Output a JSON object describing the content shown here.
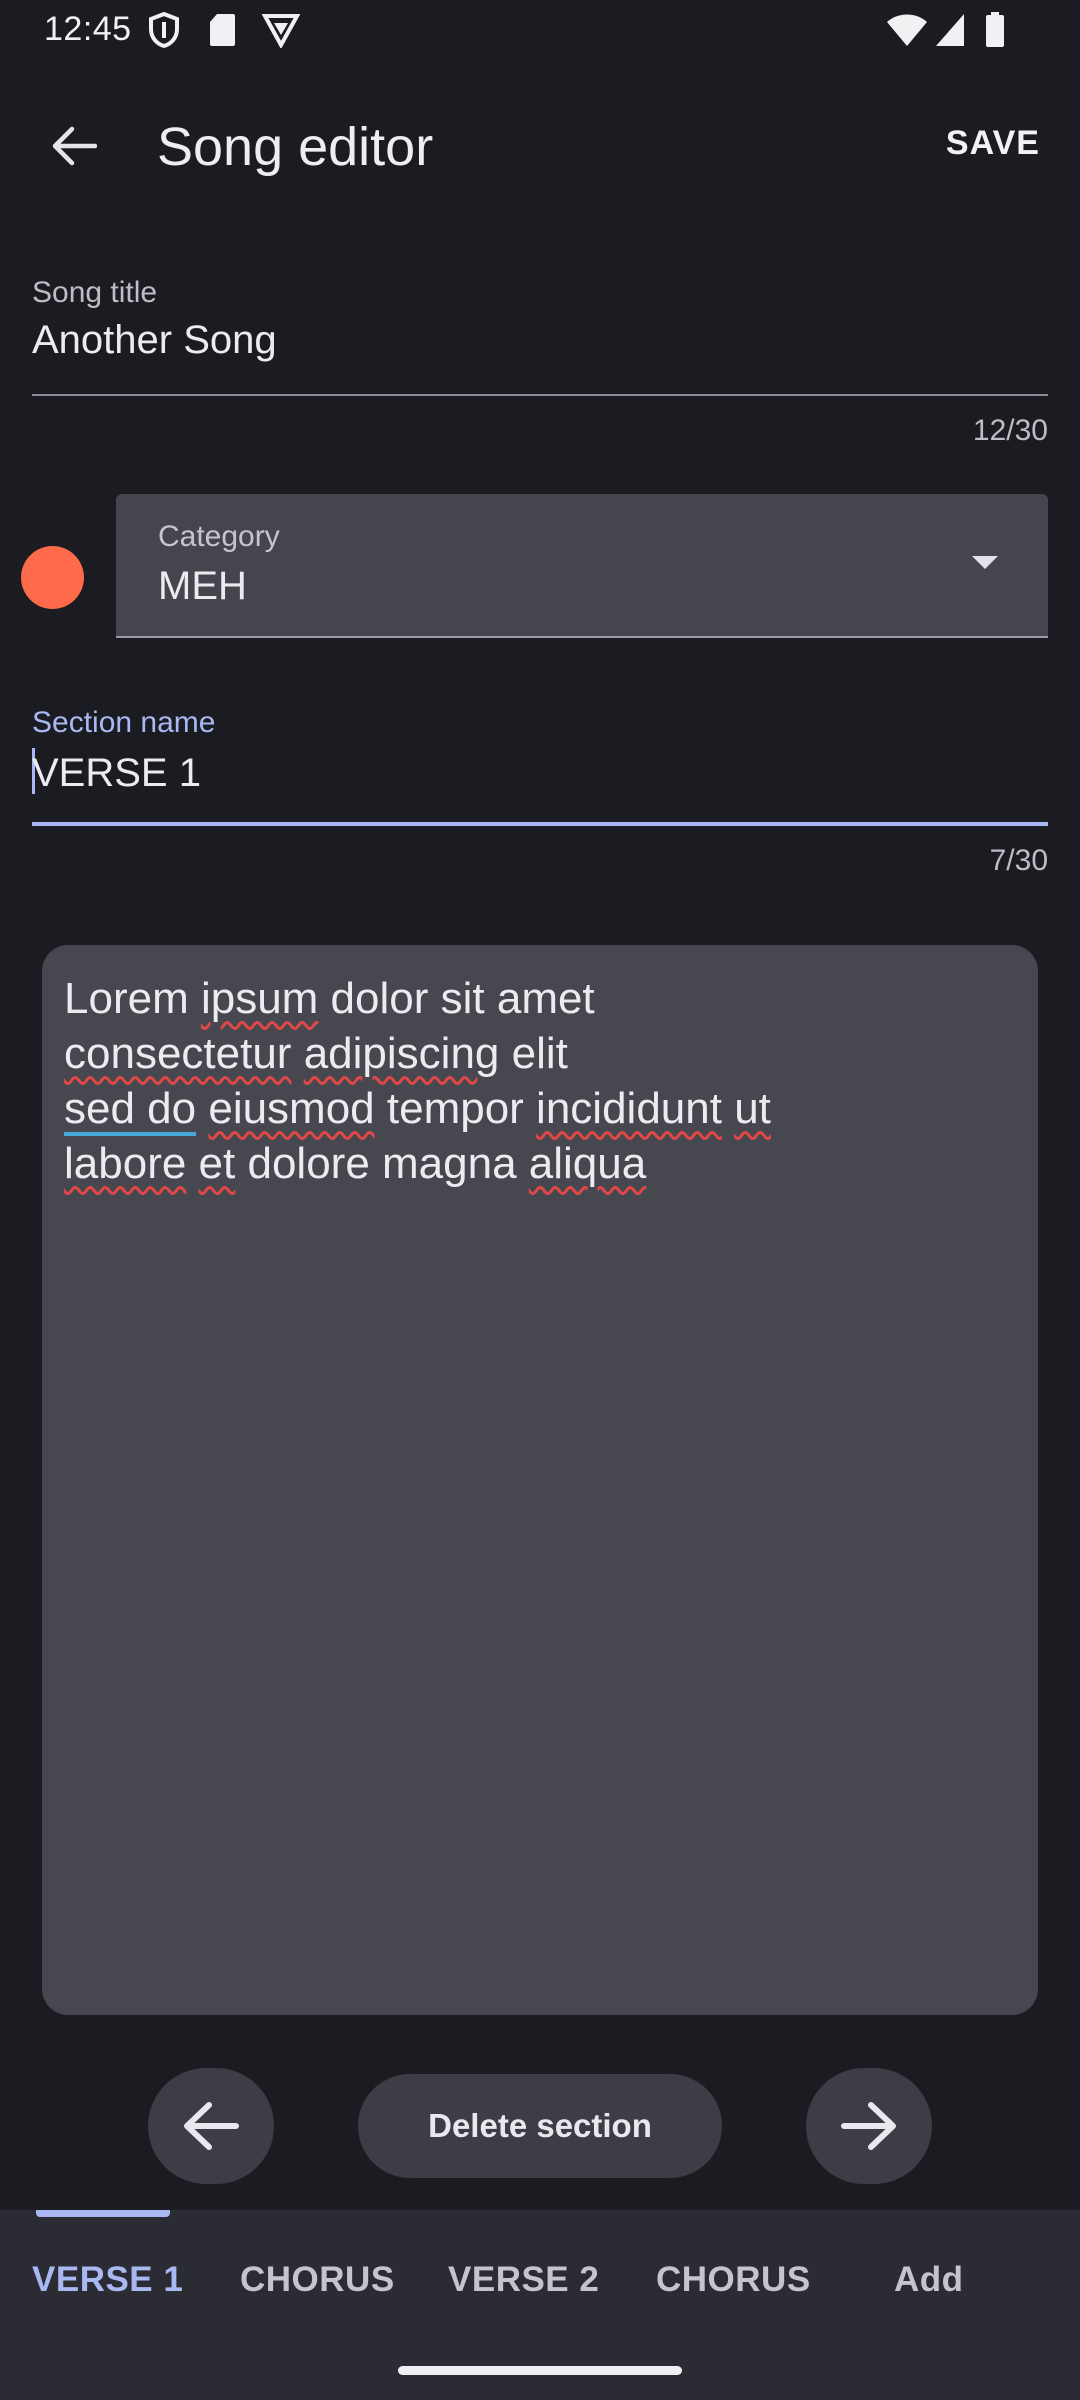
{
  "status_bar": {
    "time": "12:45",
    "icons_left": [
      "shield-icon",
      "sd-card-icon",
      "vpn-icon"
    ],
    "icons_right": [
      "wifi-icon",
      "signal-icon",
      "battery-icon"
    ]
  },
  "app_bar": {
    "title": "Song editor",
    "save_label": "SAVE",
    "back_icon": "arrow-back-icon"
  },
  "song_title_field": {
    "label": "Song title",
    "value": "Another Song",
    "counter": "12/30"
  },
  "category": {
    "label": "Category",
    "value": "MEH",
    "color": "#ff6a4a"
  },
  "section_name_field": {
    "label": "Section name",
    "value": "VERSE 1",
    "counter": "7/30"
  },
  "lyrics": {
    "lines": [
      "Lorem ipsum dolor sit amet",
      "consectetur adipiscing elit",
      "sed do eiusmod tempor incididunt ut",
      "labore et dolore magna aliqua"
    ]
  },
  "controls": {
    "prev_icon": "arrow-left-icon",
    "delete_label": "Delete section",
    "next_icon": "arrow-right-icon"
  },
  "tabs": [
    {
      "label": "VERSE 1",
      "active": true
    },
    {
      "label": "CHORUS",
      "active": false
    },
    {
      "label": "VERSE 2",
      "active": false
    },
    {
      "label": "CHORUS",
      "active": false
    },
    {
      "label": "Add",
      "active": false
    }
  ],
  "colors": {
    "background": "#1b1c22",
    "accent": "#a9b8f2",
    "surface": "#47474f"
  }
}
